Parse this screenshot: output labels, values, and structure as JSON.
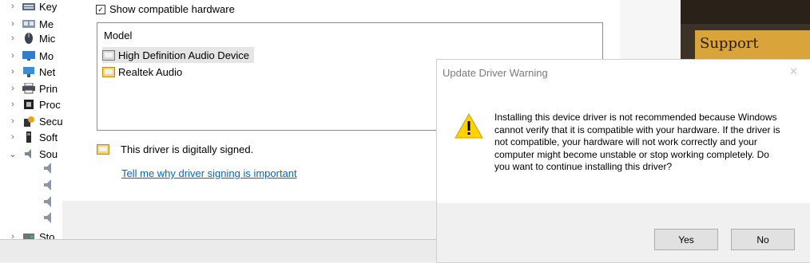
{
  "device_tree": {
    "items": [
      {
        "label": "Key",
        "icon": "keyboard-icon",
        "chevron": "›"
      },
      {
        "label": "Me",
        "icon": "memory-icon",
        "chevron": "›"
      },
      {
        "label": "Mic",
        "icon": "mouse-icon",
        "chevron": "›"
      },
      {
        "label": "Mo",
        "icon": "monitor-icon",
        "chevron": "›"
      },
      {
        "label": "Net",
        "icon": "network-adapter-icon",
        "chevron": "›"
      },
      {
        "label": "Prin",
        "icon": "printer-icon",
        "chevron": "›"
      },
      {
        "label": "Proc",
        "icon": "processor-icon",
        "chevron": "›"
      },
      {
        "label": "Secu",
        "icon": "security-icon",
        "chevron": "›"
      },
      {
        "label": "Soft",
        "icon": "software-icon",
        "chevron": "›"
      },
      {
        "label": "Sou",
        "icon": "sound-icon",
        "chevron": "⌄"
      },
      {
        "label": "Sto",
        "icon": "storage-icon",
        "chevron": "›"
      }
    ],
    "child_icon": "speaker-icon"
  },
  "wizard": {
    "show_compatible_label": "Show compatible hardware",
    "show_compatible_checked": true,
    "model_header": "Model",
    "models": [
      {
        "label": "High Definition Audio Device",
        "selected": true
      },
      {
        "label": "Realtek Audio",
        "selected": false
      }
    ],
    "signed_text": "This driver is digitally signed.",
    "signing_link": "Tell me why driver signing is important"
  },
  "background": {
    "support_text": "Support"
  },
  "warning_dialog": {
    "title": "Update Driver Warning",
    "close_glyph": "✕",
    "message": "Installing this device driver is not recommended because Windows cannot verify that it is compatible with your hardware.  If the driver is not compatible, your hardware will not work correctly and your computer might become unstable or stop working completely.  Do you want to continue installing this driver?",
    "yes_label": "Yes",
    "no_label": "No"
  },
  "colors": {
    "link": "#0066cc",
    "warning_yellow": "#ffd200",
    "selection": "#e5e5e5"
  }
}
